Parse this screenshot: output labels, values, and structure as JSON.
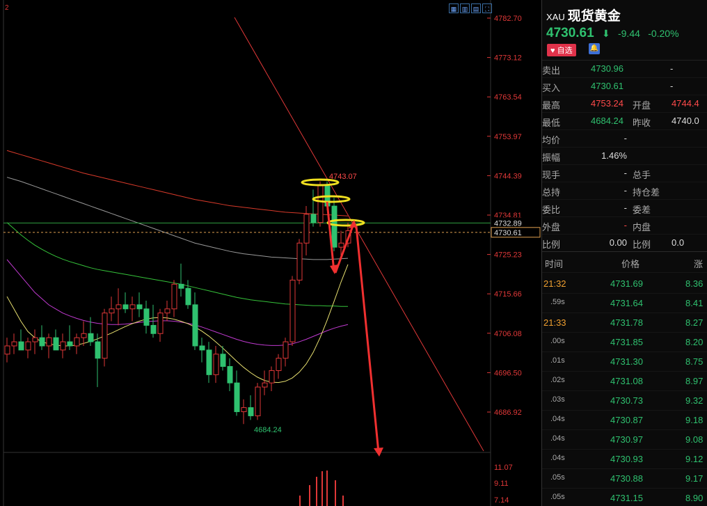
{
  "toolbar": {
    "icons": [
      "grid-icon",
      "candle-icon",
      "line-icon",
      "fullscreen-icon"
    ]
  },
  "chart": {
    "corner_label": "2",
    "price_axis": [
      "4782.70",
      "4773.12",
      "4763.54",
      "4753.97",
      "4744.39",
      "4734.81",
      "4725.23",
      "4715.66",
      "4706.08",
      "4696.50",
      "4686.92"
    ],
    "volume_axis": [
      "11.07",
      "9.11",
      "7.14"
    ],
    "high_marker": "4743.07",
    "low_marker": "4684.24",
    "last_price_tag": "4730.61",
    "line_tag": "4732.89",
    "colors": {
      "up": "#e03838",
      "down": "#2fc16f"
    },
    "candles": [
      {
        "o": 4701,
        "h": 4705,
        "l": 4699,
        "c": 4703
      },
      {
        "o": 4703,
        "h": 4706,
        "l": 4701,
        "c": 4704
      },
      {
        "o": 4704,
        "h": 4707,
        "l": 4702,
        "c": 4702
      },
      {
        "o": 4702,
        "h": 4705,
        "l": 4700,
        "c": 4704
      },
      {
        "o": 4704,
        "h": 4707,
        "l": 4701,
        "c": 4705
      },
      {
        "o": 4705,
        "h": 4708,
        "l": 4702,
        "c": 4703
      },
      {
        "o": 4703,
        "h": 4706,
        "l": 4700,
        "c": 4705
      },
      {
        "o": 4705,
        "h": 4707,
        "l": 4702,
        "c": 4702
      },
      {
        "o": 4702,
        "h": 4706,
        "l": 4700,
        "c": 4704
      },
      {
        "o": 4704,
        "h": 4708,
        "l": 4702,
        "c": 4703
      },
      {
        "o": 4703,
        "h": 4706,
        "l": 4701,
        "c": 4705
      },
      {
        "o": 4705,
        "h": 4709,
        "l": 4703,
        "c": 4706
      },
      {
        "o": 4706,
        "h": 4710,
        "l": 4703,
        "c": 4704
      },
      {
        "o": 4704,
        "h": 4706,
        "l": 4693,
        "c": 4700
      },
      {
        "o": 4700,
        "h": 4712,
        "l": 4698,
        "c": 4711
      },
      {
        "o": 4711,
        "h": 4715,
        "l": 4709,
        "c": 4712
      },
      {
        "o": 4712,
        "h": 4717,
        "l": 4708,
        "c": 4713
      },
      {
        "o": 4713,
        "h": 4716,
        "l": 4711,
        "c": 4712
      },
      {
        "o": 4712,
        "h": 4715,
        "l": 4709,
        "c": 4713
      },
      {
        "o": 4713,
        "h": 4716,
        "l": 4710,
        "c": 4712
      },
      {
        "o": 4712,
        "h": 4714,
        "l": 4706,
        "c": 4708
      },
      {
        "o": 4708,
        "h": 4713,
        "l": 4705,
        "c": 4706
      },
      {
        "o": 4706,
        "h": 4712,
        "l": 4704,
        "c": 4711
      },
      {
        "o": 4711,
        "h": 4714,
        "l": 4709,
        "c": 4712
      },
      {
        "o": 4712,
        "h": 4719,
        "l": 4710,
        "c": 4718
      },
      {
        "o": 4718,
        "h": 4723,
        "l": 4715,
        "c": 4717
      },
      {
        "o": 4717,
        "h": 4719,
        "l": 4712,
        "c": 4713
      },
      {
        "o": 4713,
        "h": 4716,
        "l": 4702,
        "c": 4703
      },
      {
        "o": 4703,
        "h": 4705,
        "l": 4699,
        "c": 4702
      },
      {
        "o": 4702,
        "h": 4704,
        "l": 4694,
        "c": 4696
      },
      {
        "o": 4696,
        "h": 4703,
        "l": 4694,
        "c": 4701
      },
      {
        "o": 4701,
        "h": 4703,
        "l": 4697,
        "c": 4698
      },
      {
        "o": 4698,
        "h": 4700,
        "l": 4692,
        "c": 4694
      },
      {
        "o": 4694,
        "h": 4697,
        "l": 4686,
        "c": 4687
      },
      {
        "o": 4687,
        "h": 4690,
        "l": 4684,
        "c": 4688
      },
      {
        "o": 4688,
        "h": 4691,
        "l": 4685,
        "c": 4686
      },
      {
        "o": 4686,
        "h": 4694,
        "l": 4685,
        "c": 4693
      },
      {
        "o": 4693,
        "h": 4697,
        "l": 4691,
        "c": 4694
      },
      {
        "o": 4694,
        "h": 4698,
        "l": 4692,
        "c": 4697
      },
      {
        "o": 4697,
        "h": 4701,
        "l": 4695,
        "c": 4700
      },
      {
        "o": 4700,
        "h": 4705,
        "l": 4698,
        "c": 4704
      },
      {
        "o": 4704,
        "h": 4720,
        "l": 4703,
        "c": 4719
      },
      {
        "o": 4719,
        "h": 4729,
        "l": 4718,
        "c": 4728
      },
      {
        "o": 4728,
        "h": 4737,
        "l": 4725,
        "c": 4735
      },
      {
        "o": 4735,
        "h": 4741,
        "l": 4732,
        "c": 4733
      },
      {
        "o": 4733,
        "h": 4743,
        "l": 4732,
        "c": 4742
      },
      {
        "o": 4742,
        "h": 4743,
        "l": 4736,
        "c": 4737
      },
      {
        "o": 4737,
        "h": 4739,
        "l": 4726,
        "c": 4727
      },
      {
        "o": 4727,
        "h": 4731,
        "l": 4725,
        "c": 4728
      },
      {
        "o": 4728,
        "h": 4733,
        "l": 4727,
        "c": 4731
      }
    ],
    "ma_gray": [
      4744,
      4743.5,
      4743,
      4742.4,
      4741.8,
      4741.2,
      4740.6,
      4740,
      4739.4,
      4738.8,
      4738.2,
      4737.6,
      4737,
      4736.4,
      4735.8,
      4735.2,
      4734.6,
      4734,
      4733.4,
      4732.8,
      4732.2,
      4731.6,
      4731,
      4730.4,
      4729.8,
      4729.2,
      4728.6,
      4728,
      4727.6,
      4727.2,
      4726.8,
      4726.4,
      4726,
      4725.7,
      4725.4,
      4725.2,
      4725,
      4724.8,
      4724.6,
      4724.5,
      4724.4,
      4724.3,
      4724.2,
      4724.1,
      4724,
      4724,
      4724,
      4724.1,
      4724.2,
      4724.3
    ],
    "ma_red": [
      4750.5,
      4750,
      4749.5,
      4749,
      4748.5,
      4748,
      4747.5,
      4747,
      4746.5,
      4746,
      4745.5,
      4745,
      4744.6,
      4744.2,
      4743.8,
      4743.4,
      4743,
      4742.6,
      4742.2,
      4741.8,
      4741.4,
      4741,
      4740.6,
      4740.2,
      4739.8,
      4739.4,
      4739,
      4738.6,
      4738.3,
      4738,
      4737.7,
      4737.4,
      4737.1,
      4736.9,
      4736.7,
      4736.5,
      4736.3,
      4736.1,
      4735.9,
      4735.7,
      4735.5,
      4735.4,
      4735.3,
      4735.2,
      4735.1,
      4735,
      4734.9,
      4734.8,
      4734.7,
      4734.6
    ],
    "ma_green": [
      4733,
      4731.5,
      4730,
      4728.7,
      4727.5,
      4726.5,
      4725.6,
      4724.8,
      4724.1,
      4723.5,
      4723,
      4722.5,
      4722,
      4721.6,
      4721.3,
      4721,
      4720.7,
      4720.4,
      4720.1,
      4719.8,
      4719.5,
      4719.2,
      4718.9,
      4718.6,
      4718.3,
      4718,
      4717.6,
      4717.2,
      4716.8,
      4716.4,
      4716,
      4715.6,
      4715.2,
      4714.8,
      4714.5,
      4714.2,
      4714,
      4713.8,
      4713.6,
      4713.4,
      4713.2,
      4713.1,
      4713,
      4712.9,
      4712.8,
      4712.8,
      4712.7,
      4712.7,
      4712.6,
      4712.6
    ],
    "ma_magenta": [
      4724,
      4722,
      4720,
      4718,
      4716,
      4714.5,
      4713,
      4712,
      4711,
      4710.3,
      4709.7,
      4709.2,
      4708.8,
      4708.5,
      4708.3,
      4708.2,
      4708.2,
      4708.3,
      4708.5,
      4708.7,
      4708.9,
      4709,
      4709.1,
      4709.1,
      4709,
      4708.8,
      4708.5,
      4708.1,
      4707.6,
      4707,
      4706.4,
      4705.8,
      4705.2,
      4704.6,
      4704.1,
      4703.7,
      4703.4,
      4703.2,
      4703.1,
      4703.1,
      4703.2,
      4703.5,
      4704,
      4704.6,
      4705.3,
      4706,
      4706.7,
      4707.3,
      4707.8,
      4708.2
    ],
    "ma_yellow": [
      4715,
      4712,
      4709,
      4706.5,
      4705,
      4704,
      4703.5,
      4703.2,
      4703,
      4703,
      4703.2,
      4703.6,
      4704.1,
      4704.7,
      4705.4,
      4706.1,
      4706.9,
      4707.7,
      4708.4,
      4709,
      4709.5,
      4709.8,
      4709.9,
      4709.8,
      4709.5,
      4709,
      4708.4,
      4707.6,
      4706.6,
      4705.4,
      4704,
      4702.5,
      4700.9,
      4699.3,
      4697.8,
      4696.5,
      4695.4,
      4694.6,
      4694.2,
      4694.1,
      4694.4,
      4695.2,
      4696.6,
      4698.6,
      4701.4,
      4705,
      4709.2,
      4713.8,
      4718.5,
      4722.8
    ]
  },
  "panel": {
    "symbol_code": "XAU",
    "symbol_name": "现货黄金",
    "price": "4730.61",
    "arrow": "⬇",
    "change": "-9.44",
    "change_pct": "-0.20%",
    "fav_label": "♥ 自选",
    "rows": [
      {
        "l1": "卖出",
        "v1": "4730.96",
        "l2": "",
        "v2": "-"
      },
      {
        "l1": "买入",
        "v1": "4730.61",
        "l2": "",
        "v2": "-"
      },
      {
        "l1": "最高",
        "v1": "4753.24",
        "l2": "开盘",
        "v2": "4744.4"
      },
      {
        "l1": "最低",
        "v1": "4684.24",
        "l2": "昨收",
        "v2": "4740.0"
      },
      {
        "l1": "均价",
        "v1": "-",
        "l2": "",
        "v2": ""
      },
      {
        "l1": "振幅",
        "v1": "1.46%",
        "l2": "",
        "v2": ""
      },
      {
        "l1": "现手",
        "v1": "-",
        "l2": "总手",
        "v2": ""
      },
      {
        "l1": "总持",
        "v1": "-",
        "l2": "持仓差",
        "v2": ""
      },
      {
        "l1": "委比",
        "v1": "-",
        "l2": "委差",
        "v2": ""
      },
      {
        "l1": "外盘",
        "v1": "-",
        "l2": "内盘",
        "v2": ""
      },
      {
        "l1": "比例",
        "v1": "0.00",
        "l2": "比例",
        "v2": "0.0"
      }
    ],
    "ticks_header": {
      "time": "时间",
      "price": "价格",
      "chg": "涨"
    },
    "ticks": [
      {
        "t": "21:32",
        "p": "4731.69",
        "c": "8.36"
      },
      {
        "t": ".59s",
        "p": "4731.64",
        "c": "8.41"
      },
      {
        "t": "21:33",
        "p": "4731.78",
        "c": "8.27"
      },
      {
        "t": ".00s",
        "p": "4731.85",
        "c": "8.20"
      },
      {
        "t": ".01s",
        "p": "4731.30",
        "c": "8.75"
      },
      {
        "t": ".02s",
        "p": "4731.08",
        "c": "8.97"
      },
      {
        "t": ".03s",
        "p": "4730.73",
        "c": "9.32"
      },
      {
        "t": ".04s",
        "p": "4730.87",
        "c": "9.18"
      },
      {
        "t": ".04s",
        "p": "4730.97",
        "c": "9.08"
      },
      {
        "t": ".04s",
        "p": "4730.93",
        "c": "9.12"
      },
      {
        "t": ".05s",
        "p": "4730.88",
        "c": "9.17"
      },
      {
        "t": ".05s",
        "p": "4731.15",
        "c": "8.90"
      }
    ]
  }
}
